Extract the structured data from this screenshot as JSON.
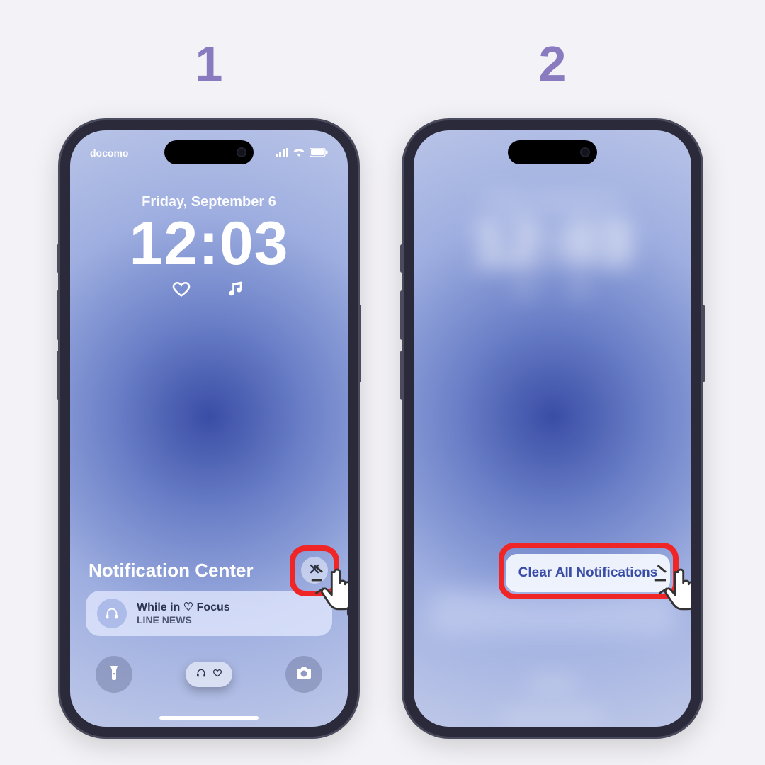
{
  "steps": {
    "one": "1",
    "two": "2"
  },
  "status": {
    "carrier": "docomo"
  },
  "lockscreen": {
    "date": "Friday, September 6",
    "time": "12:03"
  },
  "nc": {
    "title": "Notification Center",
    "notif_title": "While in ♡ Focus",
    "notif_source": "LINE NEWS"
  },
  "popup": {
    "clear_all": "Clear All Notifications"
  }
}
